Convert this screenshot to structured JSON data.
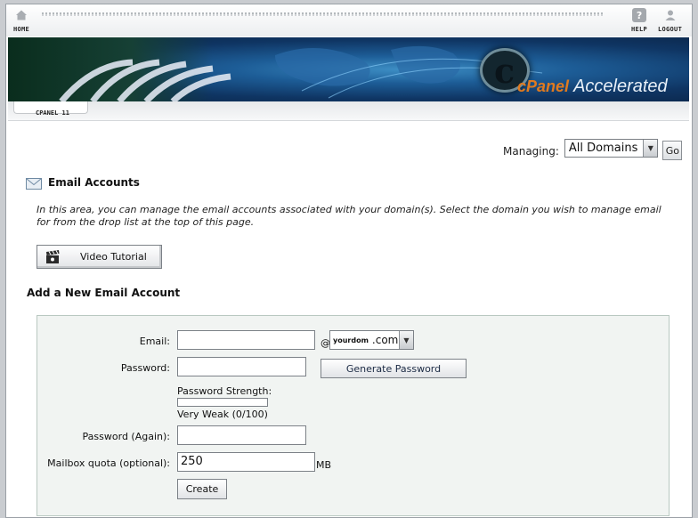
{
  "nav": {
    "home_label": "HOME",
    "help_label": "HELP",
    "logout_label": "LOGOUT"
  },
  "banner": {
    "logo_c": "c",
    "logo_brand": "cPanel",
    "logo_suffix": "Accelerated"
  },
  "strip": {
    "version_label": "CPANEL 11"
  },
  "managing": {
    "label": "Managing:",
    "selected": "All Domains",
    "go_label": "Go"
  },
  "page": {
    "title": "Email Accounts",
    "intro": "In this area, you can manage the email accounts associated with your domain(s). Select the domain you wish to manage email for from the drop list at the top of this page.",
    "video_label": "Video Tutorial",
    "add_heading": "Add a New Email Account"
  },
  "form": {
    "email_label": "Email:",
    "email_value": "",
    "at_symbol": "@",
    "domain_left": "yourdom",
    "domain_right": ".com",
    "password_label": "Password:",
    "password_value": "",
    "generate_label": "Generate Password",
    "strength_label": "Password Strength:",
    "strength_text": "Very Weak (0/100)",
    "strength_value": 0,
    "password_again_label": "Password (Again):",
    "password_again_value": "",
    "quota_label": "Mailbox quota (optional):",
    "quota_value": "250",
    "quota_unit": "MB",
    "create_label": "Create"
  },
  "colors": {
    "banner_blue": "#1d5d97",
    "logo_orange": "#e07a1f",
    "panel_bg": "#f1f4f2",
    "button_text": "#1b2a44"
  }
}
